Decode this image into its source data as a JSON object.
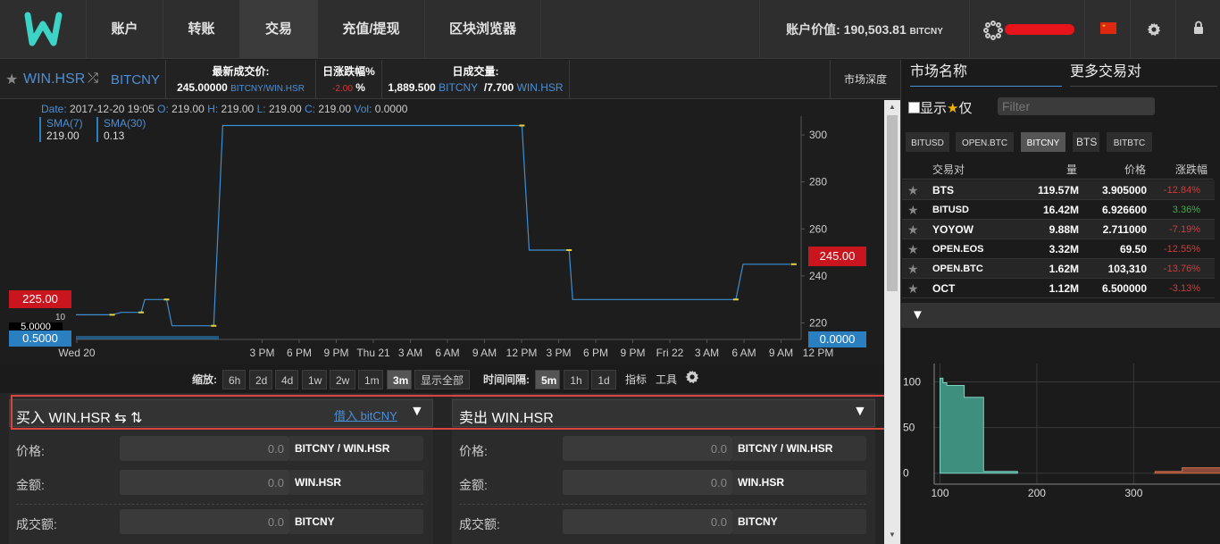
{
  "nav": {
    "items": [
      "账户",
      "转账",
      "交易",
      "充值/提现",
      "区块浏览器"
    ],
    "active_index": 2,
    "account_value_label": "账户价值:",
    "account_value": "190,503.81",
    "account_value_currency": "BITCNY"
  },
  "market": {
    "pair_base": "WIN.HSR",
    "pair_quote": "BITCNY",
    "last_price_label": "最新成交价:",
    "last_price_value": "245.00000",
    "last_price_unit": "BITCNY/WIN.HSR",
    "change_label": "日涨跌幅%",
    "change_value": "-2.00",
    "change_unit": "%",
    "volume_label": "日成交量:",
    "volume_value": "1,889.500",
    "volume_unit1": "BITCNY",
    "volume_sep": "/",
    "volume_value2": "7.700",
    "volume_unit2": "WIN.HSR",
    "depth_label": "市场深度"
  },
  "chart": {
    "info": {
      "date_label": "Date:",
      "date": "2017-12-20 19:05",
      "o_label": "O:",
      "o": "219.00",
      "h_label": "H:",
      "h": "219.00",
      "l_label": "L:",
      "l": "219.00",
      "c_label": "C:",
      "c": "219.00",
      "vol_label": "Vol:",
      "vol": "0.0000"
    },
    "sma7_label": "SMA(7)",
    "sma7_value": "219.00",
    "sma30_label": "SMA(30)",
    "sma30_value": "0.13",
    "price_tag_left": "225.00",
    "volume_tag_left": "0.5000",
    "volume_small": "5.0000",
    "volume_ten": "10",
    "price_tag_right": "245.00",
    "volume_tag_right": "0.0000",
    "colors": {
      "line": "#3d8fd1",
      "red_tag": "#c9151e",
      "blue_tag": "#2a7fc0"
    }
  },
  "chart_data": {
    "type": "line",
    "x_ticks": [
      "Wed 20",
      "3 PM",
      "6 PM",
      "9 PM",
      "Thu 21",
      "3 AM",
      "6 AM",
      "9 AM",
      "12 PM",
      "3 PM",
      "6 PM",
      "9 PM",
      "Fri 22",
      "3 AM",
      "6 AM",
      "9 AM",
      "12 PM"
    ],
    "y_ticks": [
      220,
      240,
      260,
      280,
      300
    ],
    "ylim": [
      213,
      308
    ],
    "series": [
      {
        "name": "SMA(7)",
        "points": [
          [
            0.0,
            223.5
          ],
          [
            2.0,
            223.5
          ],
          [
            2.5,
            224.5
          ],
          [
            3.6,
            224.5
          ],
          [
            3.8,
            230
          ],
          [
            5.0,
            230
          ],
          [
            5.3,
            218.8
          ],
          [
            7.6,
            218.8
          ],
          [
            8.1,
            304
          ],
          [
            24.6,
            304
          ],
          [
            25.0,
            251
          ],
          [
            27.2,
            251
          ],
          [
            27.4,
            230
          ],
          [
            36.4,
            230
          ],
          [
            36.8,
            245
          ],
          [
            39.6,
            245
          ]
        ]
      }
    ],
    "x_hours_from": "Wed 20 00:00"
  },
  "zoom": {
    "label": "缩放:",
    "buttons": [
      "6h",
      "2d",
      "4d",
      "1w",
      "2w",
      "1m",
      "3m",
      "显示全部"
    ],
    "active": "3m",
    "interval_label": "时间间隔:",
    "intervals": [
      "5m",
      "1h",
      "1d"
    ],
    "interval_active": "5m",
    "indicators": "指标",
    "tools": "工具"
  },
  "buy": {
    "title": "买入 WIN.HSR",
    "borrow": "借入 bitCNY",
    "price_label": "价格:",
    "price_value": "0.0",
    "price_unit": "BITCNY / WIN.HSR",
    "amount_label": "金额:",
    "amount_value": "0.0",
    "amount_unit": "WIN.HSR",
    "total_label": "成交额:",
    "total_value": "0.0",
    "total_unit": "BITCNY"
  },
  "sell": {
    "title": "卖出 WIN.HSR",
    "price_label": "价格:",
    "price_value": "0.0",
    "price_unit": "BITCNY / WIN.HSR",
    "amount_label": "金额:",
    "amount_value": "0.0",
    "amount_unit": "WIN.HSR",
    "total_label": "成交额:",
    "total_value": "0.0",
    "total_unit": "BITCNY"
  },
  "right": {
    "tab_market": "市场名称",
    "tab_more": "更多交易对",
    "show_only_label_pre": "显示",
    "show_only_label_post": "仅",
    "filter_placeholder": "Filter",
    "currency_tabs": [
      "BITUSD",
      "OPEN.BTC",
      "BITCNY",
      "BTS",
      "BITBTC"
    ],
    "currency_active": "BITCNY",
    "headers": [
      "交易对",
      "量",
      "价格",
      "涨跌幅"
    ],
    "rows": [
      {
        "pair": "BTS",
        "volume": "119.57M",
        "price": "3.905000",
        "change": "-12.84%",
        "up": false
      },
      {
        "pair": "BITUSD",
        "volume": "16.42M",
        "price": "6.926600",
        "change": "3.36%",
        "up": true
      },
      {
        "pair": "YOYOW",
        "volume": "9.88M",
        "price": "2.711000",
        "change": "-7.19%",
        "up": false
      },
      {
        "pair": "OPEN.EOS",
        "volume": "3.32M",
        "price": "69.50",
        "change": "-12.55%",
        "up": false
      },
      {
        "pair": "OPEN.BTC",
        "volume": "1.62M",
        "price": "103,310",
        "change": "-13.76%",
        "up": false
      },
      {
        "pair": "OCT",
        "volume": "1.12M",
        "price": "6.500000",
        "change": "-3.13%",
        "up": false
      }
    ],
    "depth": {
      "y_ticks": [
        "100",
        "50",
        "0"
      ],
      "x_ticks": [
        "100",
        "200",
        "300"
      ]
    }
  },
  "depth_data": {
    "type": "area",
    "bids": [
      [
        100,
        100
      ],
      [
        100,
        104
      ],
      [
        103,
        104
      ],
      [
        103,
        99
      ],
      [
        107,
        99
      ],
      [
        107,
        96
      ],
      [
        125,
        96
      ],
      [
        125,
        83
      ],
      [
        145,
        83
      ],
      [
        145,
        2
      ],
      [
        180,
        2
      ]
    ],
    "asks": [
      [
        322,
        0
      ],
      [
        322,
        2
      ],
      [
        350,
        2
      ],
      [
        350,
        6
      ],
      [
        390,
        6
      ]
    ],
    "xlim": [
      94,
      390
    ],
    "ylim": [
      -12,
      120
    ]
  }
}
